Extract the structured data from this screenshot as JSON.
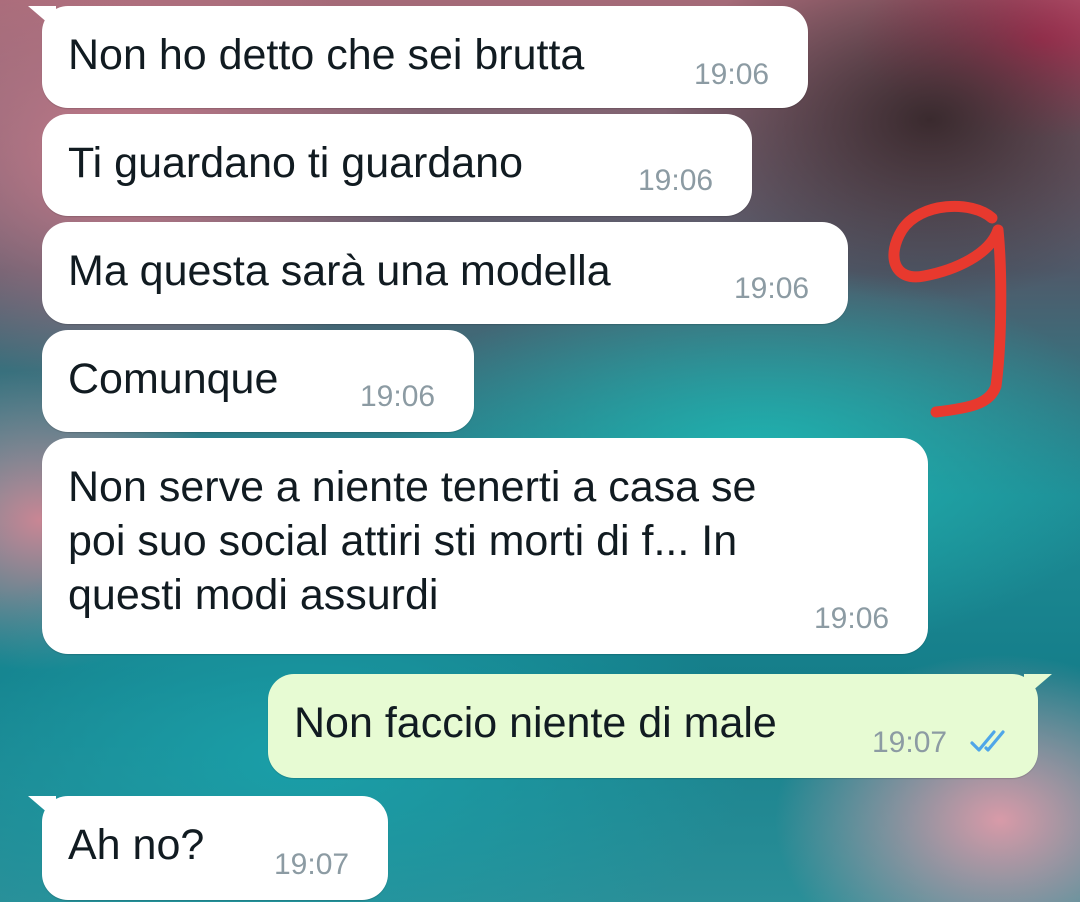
{
  "colors": {
    "incoming_bubble": "#ffffff",
    "outgoing_bubble": "#e7fbd3",
    "text": "#111b21",
    "timestamp": "#8c9ba3",
    "read_ticks": "#4fa6e8",
    "annotation": "#e8392e"
  },
  "annotation": {
    "label": "9"
  },
  "messages": [
    {
      "direction": "in",
      "text": "Non ho detto che sei brutta",
      "time": "19:06"
    },
    {
      "direction": "in",
      "text": "Ti guardano ti guardano",
      "time": "19:06"
    },
    {
      "direction": "in",
      "text": "Ma questa sarà una modella",
      "time": "19:06"
    },
    {
      "direction": "in",
      "text": "Comunque",
      "time": "19:06"
    },
    {
      "direction": "in",
      "text": "Non serve a niente tenerti a casa se\npoi suo social attiri sti morti di f...  In\nquesti modi assurdi",
      "time": "19:06"
    },
    {
      "direction": "out",
      "text": "Non faccio niente di male",
      "time": "19:07",
      "status_icon": "double-check-read-icon"
    },
    {
      "direction": "in",
      "text": "Ah no?",
      "time": "19:07"
    }
  ]
}
